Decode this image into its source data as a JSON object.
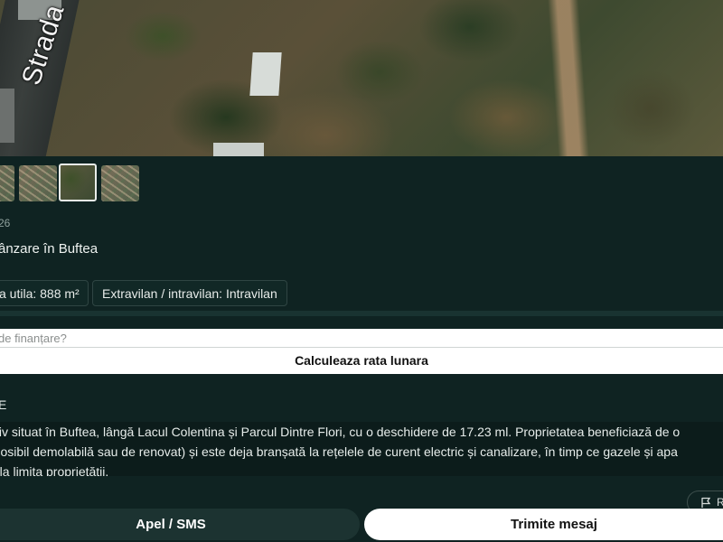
{
  "hero": {
    "street_label": "Strada Tran"
  },
  "thumbnails": [
    {
      "name": "thumbnail-1"
    },
    {
      "name": "thumbnail-2"
    },
    {
      "name": "thumbnail-3",
      "selected": true
    },
    {
      "name": "thumbnail-4"
    }
  ],
  "listing": {
    "date": "26",
    "title": "ânzare în Buftea",
    "chips": [
      {
        "label": "a utila: 888 m²"
      },
      {
        "label": "Extravilan / intravilan: Intravilan"
      }
    ]
  },
  "financing": {
    "placeholder": "de finanțare?",
    "button_label": "Calculeaza rata lunara"
  },
  "description": {
    "heading": "E",
    "lines": [
      "ctiv situat în Buftea, lângă Lacul Colentina și Parcul Dintre Flori, cu o deschidere de 17.23 ml. Proprietatea beneficiază de o",
      "(posibil demolabilă sau de renovat) și este deja branșată la rețelele de curent electric și canalizare, în timp ce gazele și apa",
      "e la limita proprietății."
    ]
  },
  "report": {
    "label": "R",
    "icon": "flag-icon"
  },
  "actions": {
    "call_label": "Apel / SMS",
    "message_label": "Trimite mesaj"
  },
  "colors": {
    "background": "#0f2322",
    "secondary_button": "#1c3331",
    "primary_button": "#ffffff"
  }
}
